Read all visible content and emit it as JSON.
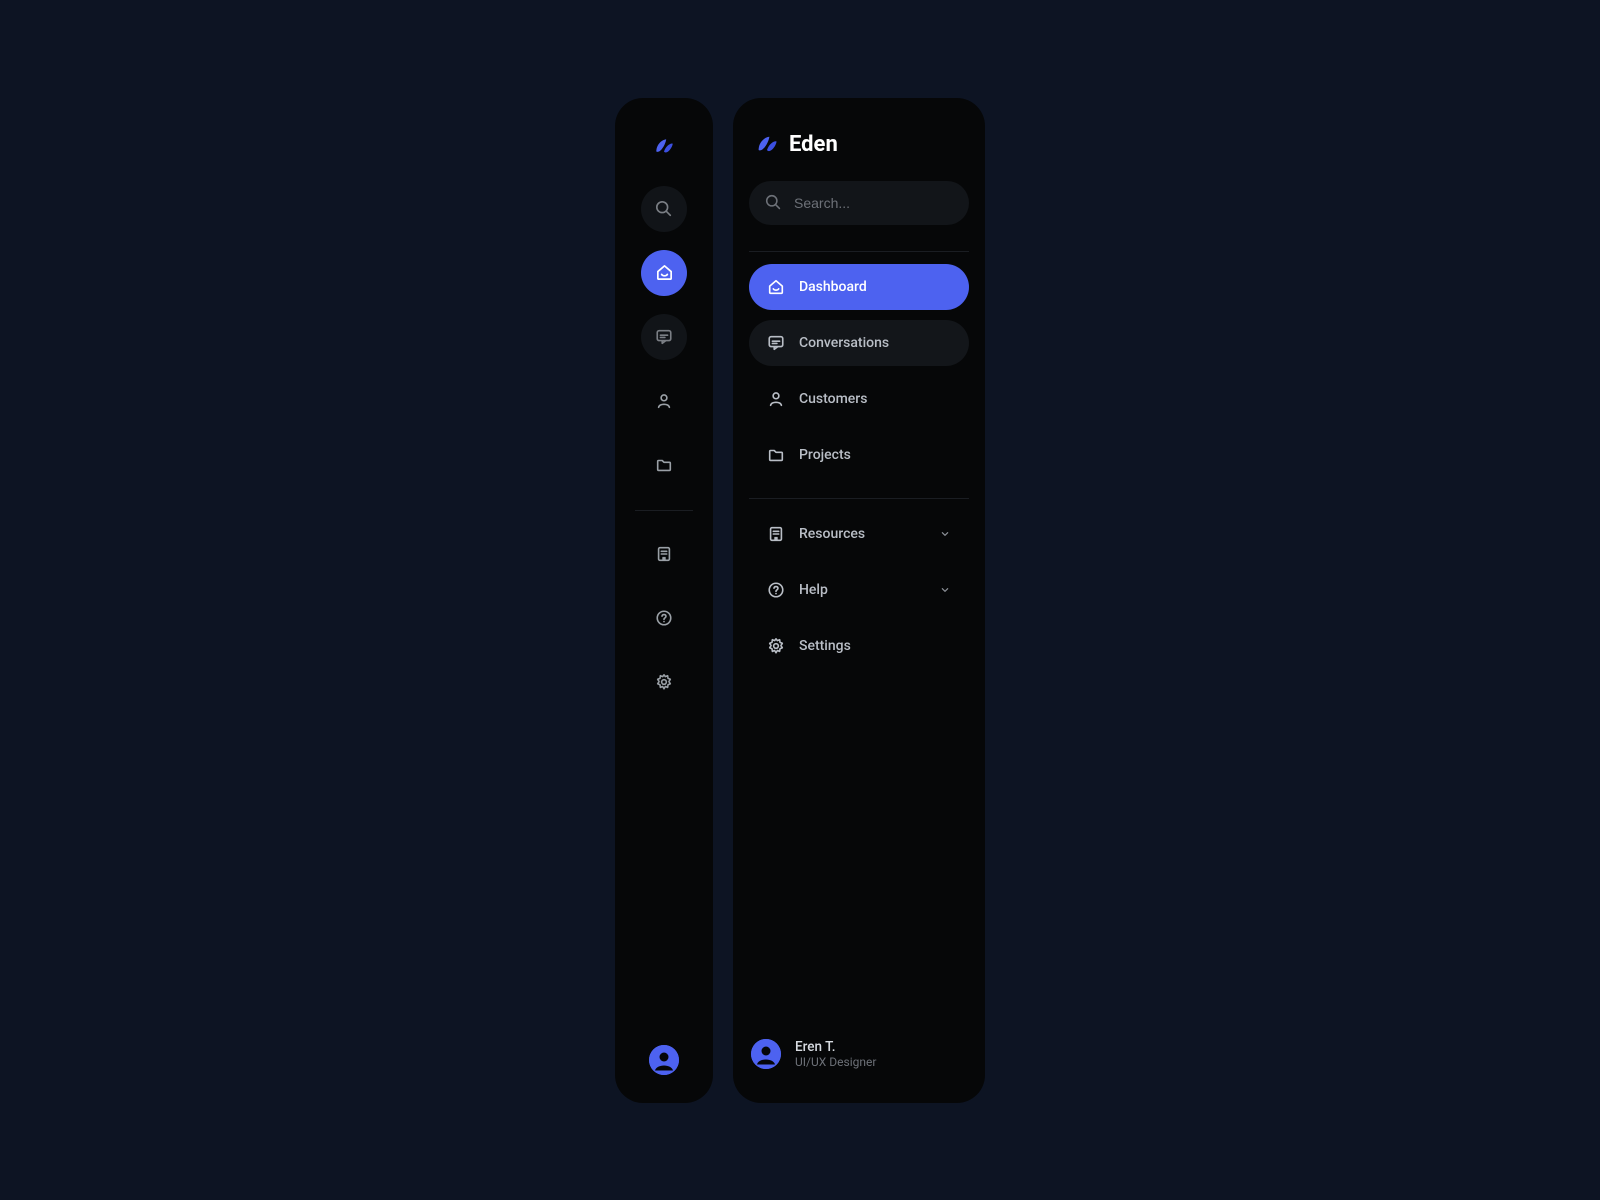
{
  "brand": {
    "name": "Eden"
  },
  "search": {
    "placeholder": "Search..."
  },
  "nav": {
    "dashboard": "Dashboard",
    "conversations": "Conversations",
    "customers": "Customers",
    "projects": "Projects",
    "resources": "Resources",
    "help": "Help",
    "settings": "Settings"
  },
  "profile": {
    "name": "Eren T.",
    "role": "UI/UX Designer"
  },
  "colors": {
    "accent": "#4d62f0",
    "panel": "#060708",
    "bg": "#0d1423"
  }
}
